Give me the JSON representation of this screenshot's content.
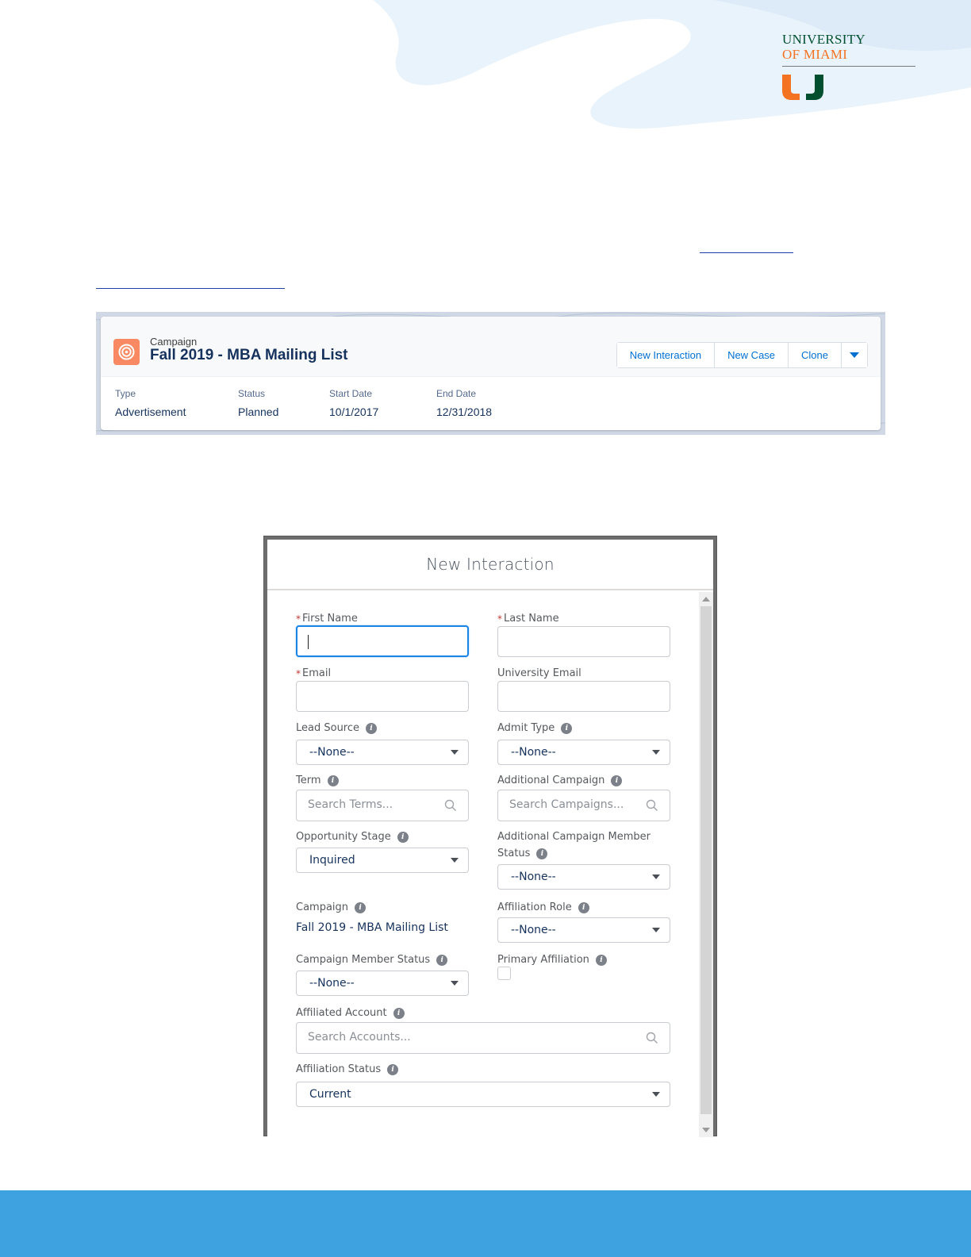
{
  "logo": {
    "line1": "UNIVERSITY",
    "line2": "OF MIAMI",
    "colors": {
      "green": "#005030",
      "orange": "#f47321"
    }
  },
  "campaign": {
    "object_label": "Campaign",
    "name": "Fall 2019 - MBA Mailing List",
    "icon": "campaign-target-icon",
    "icon_color": "#f88962",
    "actions": [
      "New Interaction",
      "New Case",
      "Clone"
    ],
    "fields": [
      {
        "label": "Type",
        "value": "Advertisement"
      },
      {
        "label": "Status",
        "value": "Planned"
      },
      {
        "label": "Start Date",
        "value": "10/1/2017"
      },
      {
        "label": "End Date",
        "value": "12/31/2018"
      }
    ]
  },
  "modal": {
    "title": "New Interaction",
    "first_name": {
      "label": "First Name",
      "value": ""
    },
    "last_name": {
      "label": "Last Name",
      "value": ""
    },
    "email": {
      "label": "Email",
      "value": ""
    },
    "university_email": {
      "label": "University Email",
      "value": ""
    },
    "lead_source": {
      "label": "Lead Source",
      "value": "--None--"
    },
    "admit_type": {
      "label": "Admit Type",
      "value": "--None--"
    },
    "term": {
      "label": "Term",
      "placeholder": "Search Terms..."
    },
    "additional_campaign": {
      "label": "Additional Campaign",
      "placeholder": "Search Campaigns..."
    },
    "opportunity_stage": {
      "label": "Opportunity Stage",
      "value": "Inquired"
    },
    "additional_campaign_member_status": {
      "label_line1": "Additional Campaign Member",
      "label_line2": "Status",
      "value": "--None--"
    },
    "campaign": {
      "label": "Campaign",
      "value": "Fall 2019 - MBA Mailing List"
    },
    "affiliation_role": {
      "label": "Affiliation Role",
      "value": "--None--"
    },
    "campaign_member_status": {
      "label": "Campaign Member Status",
      "value": "--None--"
    },
    "primary_affiliation": {
      "label": "Primary Affiliation",
      "checked": false
    },
    "affiliated_account": {
      "label": "Affiliated Account",
      "placeholder": "Search Accounts..."
    },
    "affiliation_status": {
      "label": "Affiliation Status",
      "value": "Current"
    },
    "required_marker": "*",
    "info_glyph": "i"
  },
  "footer": {
    "color": "#3ea1e0"
  }
}
